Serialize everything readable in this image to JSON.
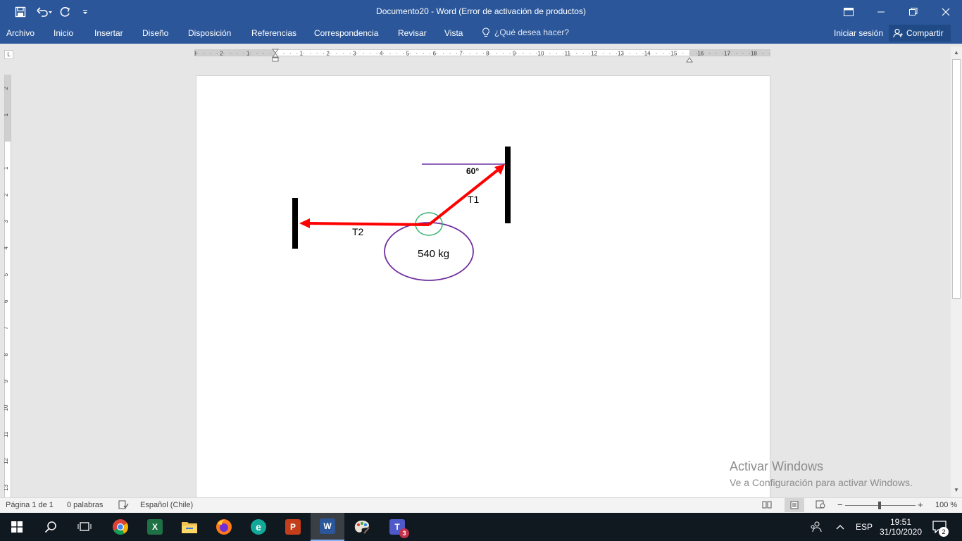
{
  "window": {
    "title": "Documento20 - Word (Error de activación de productos)"
  },
  "ribbon": {
    "tabs": [
      "Archivo",
      "Inicio",
      "Insertar",
      "Diseño",
      "Disposición",
      "Referencias",
      "Correspondencia",
      "Revisar",
      "Vista"
    ],
    "tell_me": "¿Qué desea hacer?",
    "sign_in": "Iniciar sesión",
    "share": "Compartir"
  },
  "ruler": {
    "h_numbers": [
      "3",
      "2",
      "1",
      "1",
      "2",
      "3",
      "4",
      "5",
      "6",
      "7",
      "8",
      "9",
      "10",
      "11",
      "12",
      "13",
      "14",
      "15",
      "16",
      "17",
      "18"
    ],
    "v_numbers": [
      "2",
      "1",
      "1",
      "2",
      "3",
      "4",
      "5",
      "6",
      "7",
      "8",
      "9",
      "10",
      "11",
      "12",
      "13"
    ]
  },
  "diagram": {
    "angle": "60°",
    "t1": "T1",
    "t2": "T2",
    "mass": "540 kg",
    "colors": {
      "arrow": "#ff0000",
      "ring": "#3cb371",
      "mass": "#7030a0",
      "reference": "#7030a0",
      "support": "#000000"
    }
  },
  "watermark": {
    "line1": "Activar Windows",
    "line2": "Ve a Configuración para activar Windows."
  },
  "status": {
    "page": "Página 1 de 1",
    "words": "0 palabras",
    "language": "Español (Chile)",
    "zoom": "100 %"
  },
  "taskbar": {
    "lang": "ESP",
    "time": "19:51",
    "date": "31/10/2020",
    "notifications": "2",
    "teams_badge": "3"
  }
}
